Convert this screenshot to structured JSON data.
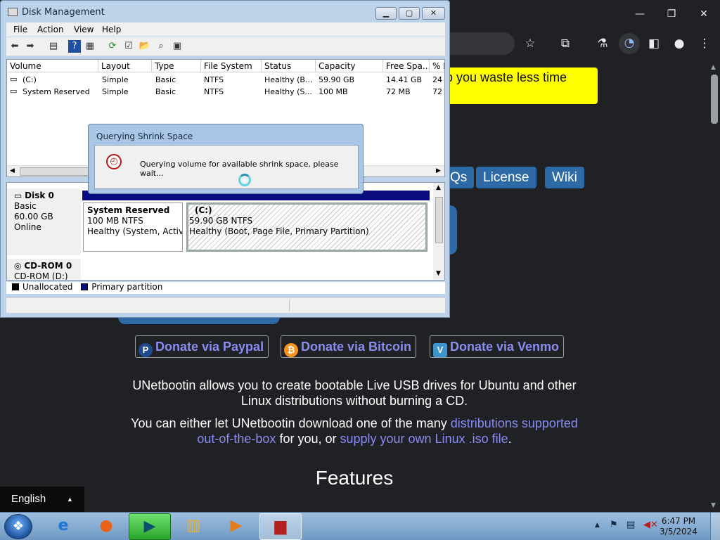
{
  "browser": {
    "banner_text": "lp you waste less time",
    "nav": {
      "faqs": "Qs",
      "license": "License",
      "wiki": "Wiki"
    },
    "donate": {
      "paypal": "Donate via Paypal",
      "bitcoin": "Donate via Bitcoin",
      "venmo": "Donate via Venmo",
      "paypal_icon": "P",
      "bitcoin_icon": "₿",
      "venmo_icon": "V"
    },
    "para1_line1": "UNetbootin allows you to create bootable Live USB drives for Ubuntu and other",
    "para1_line2": "Linux distributions without burning a CD.",
    "para2_line1_pre": "You can either let UNetbootin download one of the many ",
    "para2_link1a": "distributions supported",
    "para2_link1b": "out-of-the-box",
    "para2_mid": " for you, or ",
    "para2_link2": "supply your own Linux .iso file",
    "para2_end": ".",
    "features_heading": "Features",
    "language": "English",
    "colors": {
      "banner": "#ffff00",
      "nav": "#2d6aa6",
      "link": "#8a8cf0"
    }
  },
  "disk_mgmt": {
    "title": "Disk Management",
    "menu": [
      "File",
      "Action",
      "View",
      "Help"
    ],
    "columns": [
      "Volume",
      "Layout",
      "Type",
      "File System",
      "Status",
      "Capacity",
      "Free Spa...",
      "% F"
    ],
    "rows": [
      [
        "(C:)",
        "Simple",
        "Basic",
        "NTFS",
        "Healthy (B...",
        "59.90 GB",
        "14.41 GB",
        "24"
      ],
      [
        "System Reserved",
        "Simple",
        "Basic",
        "NTFS",
        "Healthy (S...",
        "100 MB",
        "72 MB",
        "72"
      ]
    ],
    "disk0": {
      "name": "Disk 0",
      "type": "Basic",
      "size": "60.00 GB",
      "state": "Online"
    },
    "cdrom": {
      "name": "CD-ROM 0",
      "drive": "CD-ROM (D:)"
    },
    "part_sys": {
      "name": "System Reserved",
      "fs": "100 MB NTFS",
      "status": "Healthy (System, Active,"
    },
    "part_c": {
      "name": "(C:)",
      "fs": "59.90 GB NTFS",
      "status": "Healthy (Boot, Page File, Primary Partition)"
    },
    "legend": {
      "unallocated": "Unallocated",
      "primary": "Primary partition"
    }
  },
  "dialog": {
    "title": "Querying Shrink Space",
    "message": "Querying volume for available shrink space, please wait..."
  },
  "taskbar": {
    "time": "6:47 PM",
    "date": "3/5/2024"
  }
}
